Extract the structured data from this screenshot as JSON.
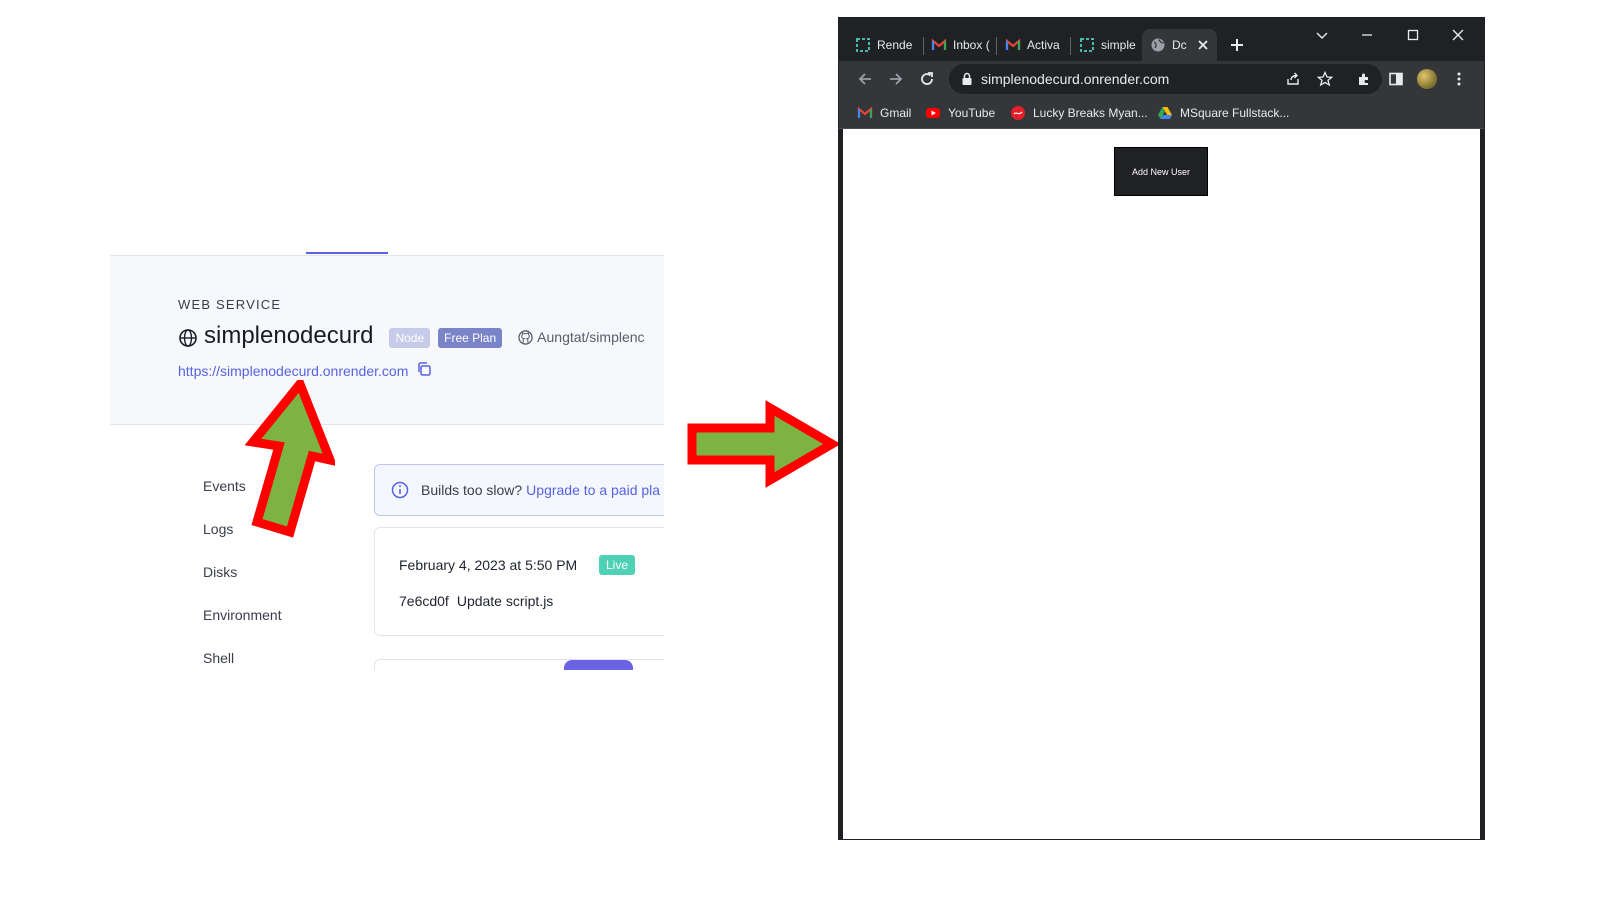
{
  "render": {
    "service_type": "WEB SERVICE",
    "service_name": "simplenodecurd",
    "badge_runtime": "Node",
    "badge_plan": "Free Plan",
    "repo": "Aungtat/simplenc",
    "service_url": "https://simplenodecurd.onrender.com",
    "nav": [
      {
        "label": "Events"
      },
      {
        "label": "Logs"
      },
      {
        "label": "Disks"
      },
      {
        "label": "Environment"
      },
      {
        "label": "Shell"
      }
    ],
    "notice": {
      "text": "Builds too slow?",
      "link": "Upgrade to a paid pla"
    },
    "deploy": {
      "date": "February 4, 2023 at 5:50 PM",
      "status": "Live",
      "commit_hash": "7e6cd0f",
      "commit_message": "Update script.js"
    },
    "colors": {
      "accent": "#5662e0",
      "live": "#4fd1b6",
      "badge_plan": "#7a84c8",
      "badge_node": "#c6cbea"
    }
  },
  "annotations": {
    "arrow_fill": "#7cb342",
    "arrow_outline": "#ff0000"
  },
  "browser": {
    "tabs": [
      {
        "label": "Rende",
        "icon": "render-icon"
      },
      {
        "label": "Inbox (",
        "icon": "gmail-icon"
      },
      {
        "label": "Activa",
        "icon": "gmail-icon"
      },
      {
        "label": "simple",
        "icon": "render-icon"
      },
      {
        "label": "Dc",
        "icon": "globe-icon",
        "active": true
      }
    ],
    "address": "simplenodecurd.onrender.com",
    "bookmarks": [
      {
        "label": "Gmail",
        "icon": "gmail-icon"
      },
      {
        "label": "YouTube",
        "icon": "youtube-icon"
      },
      {
        "label": "Lucky Breaks Myan...",
        "icon": "coca-cola-icon"
      },
      {
        "label": "MSquare Fullstack...",
        "icon": "google-drive-icon"
      }
    ],
    "page": {
      "button_label": "Add New User"
    }
  }
}
